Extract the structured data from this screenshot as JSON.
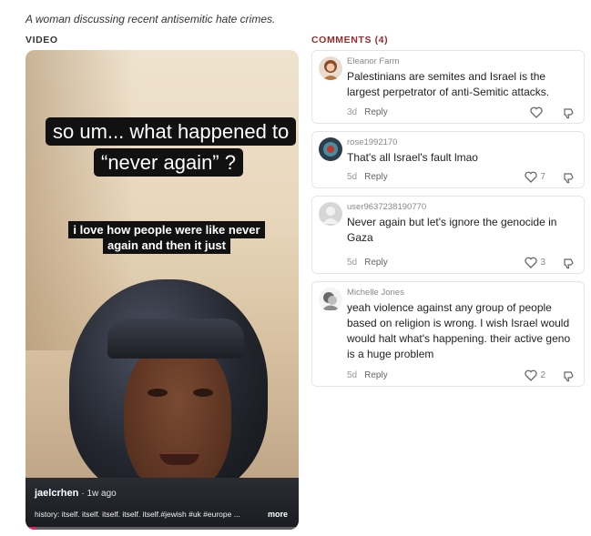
{
  "caption": "A woman discussing recent antisemitic hate crimes.",
  "video_label": "VIDEO",
  "comments_label": "COMMENTS (4)",
  "video": {
    "overlay_main": "so um... what happened to “never again” ?",
    "overlay_sub": "i love how people were like never again and then it just",
    "author": "jaelcrhen",
    "ago": "· 1w ago",
    "history": "history: itself. itself. itself. itself. itself.#jewish #uk #europe ...",
    "more": "more",
    "progress": 0.04
  },
  "comments": [
    {
      "user": "Eleanor Farm",
      "text": "Palestinians are semites and Israel is the largest perpetrator of anti-Semitic attacks.",
      "time": "3d",
      "reply": "Reply",
      "likes": ""
    },
    {
      "user": "rose1992170",
      "text": "That's all Israel's fault lmao",
      "time": "5d",
      "reply": "Reply",
      "likes": "7"
    },
    {
      "user": "user9637238190770",
      "text": "Never again but let's ignore the genocide in Gaza",
      "time": "5d",
      "reply": "Reply",
      "likes": "3"
    },
    {
      "user": "Michelle Jones",
      "text": "yeah violence against any group of people based on religion is wrong. I wish Israel would would halt what's happening. their active geno is a huge problem",
      "time": "5d",
      "reply": "Reply",
      "likes": "2"
    }
  ],
  "colors": {
    "comments_label": "#9b2a2a",
    "progress": "#e0245e"
  }
}
